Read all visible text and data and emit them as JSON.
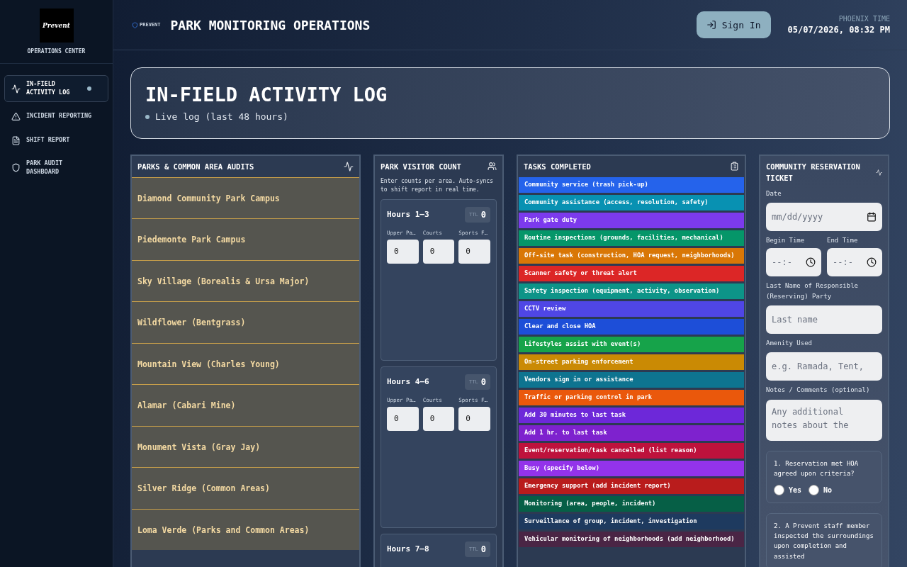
{
  "sidebar": {
    "logo": {
      "name": "Prevent"
    },
    "subtitle": "OPERATIONS CENTER",
    "items": [
      {
        "label": "IN-FIELD ACTIVITY LOG",
        "selected": true
      },
      {
        "label": "INCIDENT REPORTING",
        "selected": false
      },
      {
        "label": "SHIFT REPORT",
        "selected": false
      },
      {
        "label": "PARK AUDIT DASHBOARD",
        "selected": false
      }
    ]
  },
  "header": {
    "brand": "PREVENT",
    "title": "PARK MONITORING OPERATIONS",
    "sign_in": "Sign In",
    "time_label": "PHOENIX TIME",
    "time": "05/07/2026, 08:32 PM"
  },
  "hero": {
    "title": "IN-FIELD ACTIVITY LOG",
    "status": "Live log (last 48 hours)"
  },
  "audits": {
    "title": "PARKS & COMMON AREA AUDITS",
    "parks": [
      "Diamond Community Park Campus",
      "Piedemonte Park Campus",
      "Sky Village (Borealis & Ursa Major)",
      "Wildflower (Bentgrass)",
      "Mountain View (Charles Young)",
      "Alamar (Cabari Mine)",
      "Monument Vista (Gray Jay)",
      "Silver Ridge (Common Areas)",
      "Loma Verde (Parks and Common Areas)"
    ]
  },
  "visitor_count": {
    "title": "PARK VISITOR COUNT",
    "note": "Enter counts per area. Auto-syncs to shift report in real time.",
    "blocks": [
      {
        "label": "Hours 1–3",
        "ttl_label": "TTL",
        "total": "0",
        "areas": [
          {
            "label": "Upper Pa…",
            "value": "0"
          },
          {
            "label": "Courts",
            "value": "0"
          },
          {
            "label": "Sports F…",
            "value": "0"
          }
        ]
      },
      {
        "label": "Hours 4–6",
        "ttl_label": "TTL",
        "total": "0",
        "areas": [
          {
            "label": "Upper Pa…",
            "value": "0"
          },
          {
            "label": "Courts",
            "value": "0"
          },
          {
            "label": "Sports F…",
            "value": "0"
          }
        ]
      },
      {
        "label": "Hours 7–8",
        "ttl_label": "TTL",
        "total": "0"
      }
    ]
  },
  "tasks": {
    "title": "TASKS COMPLETED",
    "items": [
      {
        "label": "Community service (trash pick-up)",
        "color": "#2563eb"
      },
      {
        "label": "Community assistance (access, resolution, safety)",
        "color": "#0891b2"
      },
      {
        "label": "Park gate duty",
        "color": "#7c3aed"
      },
      {
        "label": "Routine inspections (grounds, facilities, mechanical)",
        "color": "#059669"
      },
      {
        "label": "Off-site task (construction, HOA request, neighborhoods)",
        "color": "#d97706"
      },
      {
        "label": "Scanner safety or threat alert",
        "color": "#dc2626"
      },
      {
        "label": "Safety inspection (equipment, activity, observation)",
        "color": "#0d9488"
      },
      {
        "label": "CCTV review",
        "color": "#4f46e5"
      },
      {
        "label": "Clear and close HOA",
        "color": "#1d4ed8"
      },
      {
        "label": "Lifestyles assist with event(s)",
        "color": "#16a34a"
      },
      {
        "label": "On-street parking enforcement",
        "color": "#ca8a04"
      },
      {
        "label": "Vendors sign in or assistance",
        "color": "#0e7490"
      },
      {
        "label": "Traffic or parking control in park",
        "color": "#ea580c"
      },
      {
        "label": "Add 30 minutes to last task",
        "color": "#6d28d9"
      },
      {
        "label": "Add 1 hr. to last task",
        "color": "#7e22ce"
      },
      {
        "label": "Event/reservation/task cancelled (list reason)",
        "color": "#be123c"
      },
      {
        "label": "Busy (specify below)",
        "color": "#9333ea"
      },
      {
        "label": "Emergency support (add incident report)",
        "color": "#b91c1c"
      },
      {
        "label": "Monitoring (area, people, incident)",
        "color": "#065f46"
      },
      {
        "label": "Surveillance of group, incident, investigation",
        "color": "#1e3a5f"
      },
      {
        "label": "Vehicular monitoring of neighborhoods (add neighborhood)",
        "color": "#4a2545"
      }
    ]
  },
  "reservation": {
    "title": "COMMUNITY RESERVATION TICKET",
    "date": {
      "label": "Date",
      "placeholder": "mm/dd/yyyy"
    },
    "begin": {
      "label": "Begin Time",
      "placeholder": "--:-"
    },
    "end": {
      "label": "End Time",
      "placeholder": "--:-"
    },
    "last_name": {
      "label": "Last Name of Responsible (Reserving) Party",
      "placeholder": "Last name"
    },
    "amenity": {
      "label": "Amenity Used",
      "placeholder": "e.g. Ramada, Tent,"
    },
    "notes": {
      "label": "Notes / Comments (optional)",
      "placeholder": "Any additional notes about the"
    },
    "questions": [
      {
        "text": "1. Reservation met HOA agreed upon criteria?",
        "options": [
          {
            "label": "Yes",
            "checked": false
          },
          {
            "label": "No",
            "checked": false
          }
        ]
      },
      {
        "text": "2. A Prevent staff member inspected the surroundings upon completion and assisted"
      }
    ]
  }
}
